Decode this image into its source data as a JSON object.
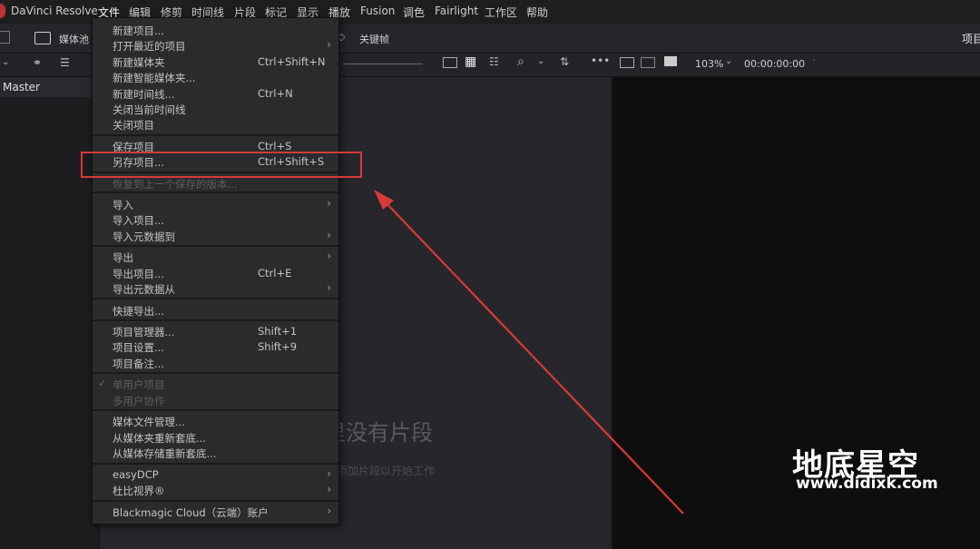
{
  "menubar": {
    "app_name": "DaVinci Resolve",
    "items": [
      "文件",
      "编辑",
      "修剪",
      "时间线",
      "片段",
      "标记",
      "显示",
      "播放",
      "Fusion",
      "调色",
      "Fairlight",
      "工作区",
      "帮助"
    ]
  },
  "toolbar": {
    "media_pool_label": "媒体池",
    "keyframes_label": "关键帧",
    "project_label": "项目",
    "zoom": "103%",
    "timecode": "00:00:00:00"
  },
  "left_panel": {
    "header": "Master"
  },
  "media_pool": {
    "empty_title": "里没有片段",
    "empty_subtitle": "添加片段以开始工作"
  },
  "file_menu": {
    "items": [
      {
        "label": "新建项目...",
        "shortcut": "",
        "submenu": false,
        "disabled": false
      },
      {
        "label": "打开最近的项目",
        "shortcut": "",
        "submenu": true,
        "disabled": false
      },
      {
        "label": "新建媒体夹",
        "shortcut": "Ctrl+Shift+N",
        "submenu": false,
        "disabled": false
      },
      {
        "label": "新建智能媒体夹...",
        "shortcut": "",
        "submenu": false,
        "disabled": false
      },
      {
        "label": "新建时间线...",
        "shortcut": "Ctrl+N",
        "submenu": false,
        "disabled": false
      },
      {
        "label": "关闭当前时间线",
        "shortcut": "",
        "submenu": false,
        "disabled": false
      },
      {
        "label": "关闭项目",
        "shortcut": "",
        "submenu": false,
        "disabled": false
      },
      {
        "label": "保存项目",
        "shortcut": "Ctrl+S",
        "submenu": false,
        "disabled": false
      },
      {
        "label": "另存项目...",
        "shortcut": "Ctrl+Shift+S",
        "submenu": false,
        "disabled": false
      },
      {
        "label": "恢复到上一个保存的版本...",
        "shortcut": "",
        "submenu": false,
        "disabled": true
      },
      {
        "label": "导入",
        "shortcut": "",
        "submenu": true,
        "disabled": false
      },
      {
        "label": "导入项目...",
        "shortcut": "",
        "submenu": false,
        "disabled": false
      },
      {
        "label": "导入元数据到",
        "shortcut": "",
        "submenu": true,
        "disabled": false
      },
      {
        "label": "导出",
        "shortcut": "",
        "submenu": true,
        "disabled": false
      },
      {
        "label": "导出项目...",
        "shortcut": "Ctrl+E",
        "submenu": false,
        "disabled": false
      },
      {
        "label": "导出元数据从",
        "shortcut": "",
        "submenu": true,
        "disabled": false
      },
      {
        "label": "快捷导出...",
        "shortcut": "",
        "submenu": false,
        "disabled": false
      },
      {
        "label": "项目管理器...",
        "shortcut": "Shift+1",
        "submenu": false,
        "disabled": false
      },
      {
        "label": "项目设置...",
        "shortcut": "Shift+9",
        "submenu": false,
        "disabled": false
      },
      {
        "label": "项目备注...",
        "shortcut": "",
        "submenu": false,
        "disabled": false
      },
      {
        "label": "单用户项目",
        "shortcut": "",
        "submenu": false,
        "disabled": true
      },
      {
        "label": "多用户协作",
        "shortcut": "",
        "submenu": false,
        "disabled": true
      },
      {
        "label": "媒体文件管理...",
        "shortcut": "",
        "submenu": false,
        "disabled": false
      },
      {
        "label": "从媒体夹重新套底...",
        "shortcut": "",
        "submenu": false,
        "disabled": false
      },
      {
        "label": "从媒体存储重新套底...",
        "shortcut": "",
        "submenu": false,
        "disabled": false
      },
      {
        "label": "easyDCP",
        "shortcut": "",
        "submenu": true,
        "disabled": false
      },
      {
        "label": "杜比视界®",
        "shortcut": "",
        "submenu": true,
        "disabled": false
      },
      {
        "label": "Blackmagic Cloud（云端）账户",
        "shortcut": "",
        "submenu": true,
        "disabled": false
      }
    ],
    "checked_item": "单用户项目"
  },
  "watermark": {
    "title": "地底星空",
    "url": "www.didixk.com"
  },
  "colors": {
    "highlight": "#d63a3a",
    "arrow": "#d63a3a"
  }
}
